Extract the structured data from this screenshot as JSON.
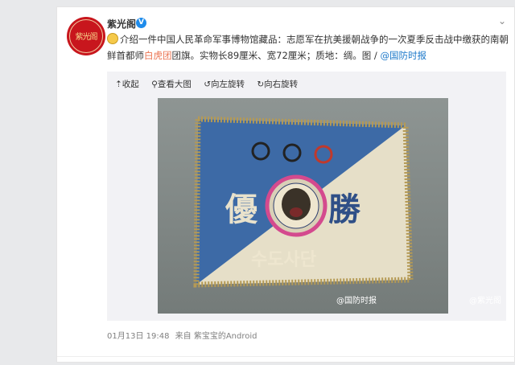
{
  "user": {
    "name": "紫光阁",
    "avatar_text": "紫光阁"
  },
  "post": {
    "pre_text": "介绍一件中国人民革命军事博物馆藏品：志愿军在抗美援朝战争的一次夏季反击战中缴获的南朝鲜首都师",
    "link_text": "白虎团",
    "post_text": "团旗。实物长89厘米、宽72厘米；质地：绸。图 / ",
    "mention": "@国防时报"
  },
  "toolbar": {
    "collapse": "⇡收起",
    "view_large": "查看大图",
    "rotate_left": "向左旋转",
    "rotate_right": "向右旋转"
  },
  "flag": {
    "left_char": "優",
    "right_char": "勝",
    "korean": "수도사단"
  },
  "watermarks": {
    "left": "@国防时报",
    "right": "@紫光阁"
  },
  "meta": {
    "time": "01月13日 19:48",
    "source": "来自 紫宝宝的Android"
  },
  "colors": {
    "accent": "#eb7350",
    "link": "#1a77c9",
    "flag_blue": "#3d6aa6",
    "flag_cream": "#e6dfc8"
  }
}
